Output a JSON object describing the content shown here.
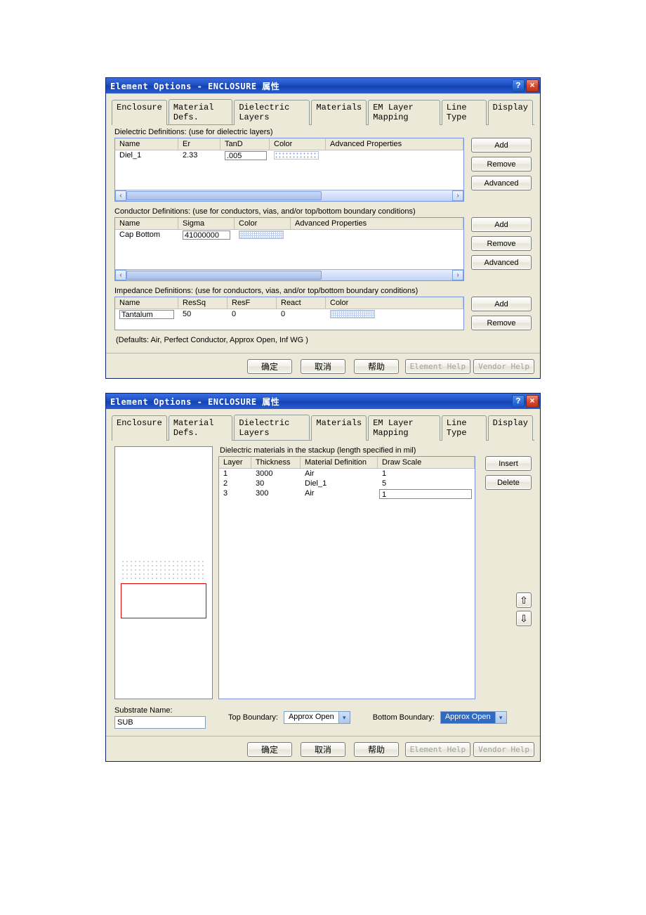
{
  "colors": {
    "accent": "#1a4bbe",
    "panel": "#ece9d8"
  },
  "dialog1": {
    "title": "Element Options - ENCLOSURE 属性",
    "tabs": [
      "Enclosure",
      "Material Defs.",
      "Dielectric Layers",
      "Materials",
      "EM Layer Mapping",
      "Line Type",
      "Display"
    ],
    "active_tab": 1,
    "dielectric_caption": "Dielectric Definitions: (use for dielectric layers)",
    "dielectric_headers": [
      "Name",
      "Er",
      "TanD",
      "Color",
      "Advanced Properties"
    ],
    "dielectric_rows": [
      {
        "name": "Diel_1",
        "er": "2.33",
        "tand": ".005",
        "swatch": "dots",
        "adv": ""
      }
    ],
    "conductor_caption": "Conductor Definitions: (use for conductors, vias, and/or top/bottom boundary conditions)",
    "conductor_headers": [
      "Name",
      "Sigma",
      "Color",
      "Advanced Properties"
    ],
    "conductor_rows": [
      {
        "name": "Cap Bottom",
        "sigma": "41000000",
        "swatch": "grid",
        "adv": ""
      }
    ],
    "impedance_caption": "Impedance Definitions: (use for conductors, vias, and/or top/bottom boundary conditions)",
    "impedance_headers": [
      "Name",
      "ResSq",
      "ResF",
      "React",
      "Color"
    ],
    "impedance_rows": [
      {
        "name": "Tantalum",
        "ressq": "50",
        "resf": "0",
        "react": "0",
        "swatch": "grid"
      }
    ],
    "defaults_text": "(Defaults:  Air, Perfect Conductor, Approx Open, Inf WG  )",
    "side_buttons": {
      "add": "Add",
      "remove": "Remove",
      "advanced": "Advanced"
    },
    "footer": {
      "ok": "确定",
      "cancel": "取消",
      "help_cn": "帮助",
      "element_help": "Element Help",
      "vendor_help": "Vendor Help"
    }
  },
  "dialog2": {
    "title": "Element Options - ENCLOSURE 属性",
    "tabs": [
      "Enclosure",
      "Material Defs.",
      "Dielectric Layers",
      "Materials",
      "EM Layer Mapping",
      "Line Type",
      "Display"
    ],
    "active_tab": 2,
    "caption": "Dielectric materials in the stackup (length specified in mil)",
    "headers": [
      "Layer",
      "Thickness",
      "Material Definition",
      "Draw Scale"
    ],
    "rows": [
      {
        "layer": "1",
        "thickness": "3000",
        "mat": "Air",
        "scale": "1"
      },
      {
        "layer": "2",
        "thickness": "30",
        "mat": "Diel_1",
        "scale": "5"
      },
      {
        "layer": "3",
        "thickness": "300",
        "mat": "Air",
        "scale": "1",
        "scale_editing": true
      }
    ],
    "side_buttons": {
      "insert": "Insert",
      "delete": "Delete"
    },
    "substrate_label": "Substrate Name:",
    "substrate_value": "SUB",
    "top_boundary_label": "Top Boundary:",
    "top_boundary_value": "Approx Open",
    "bottom_boundary_label": "Bottom Boundary:",
    "bottom_boundary_value": "Approx Open",
    "footer": {
      "ok": "确定",
      "cancel": "取消",
      "help_cn": "帮助",
      "element_help": "Element Help",
      "vendor_help": "Vendor Help"
    }
  }
}
